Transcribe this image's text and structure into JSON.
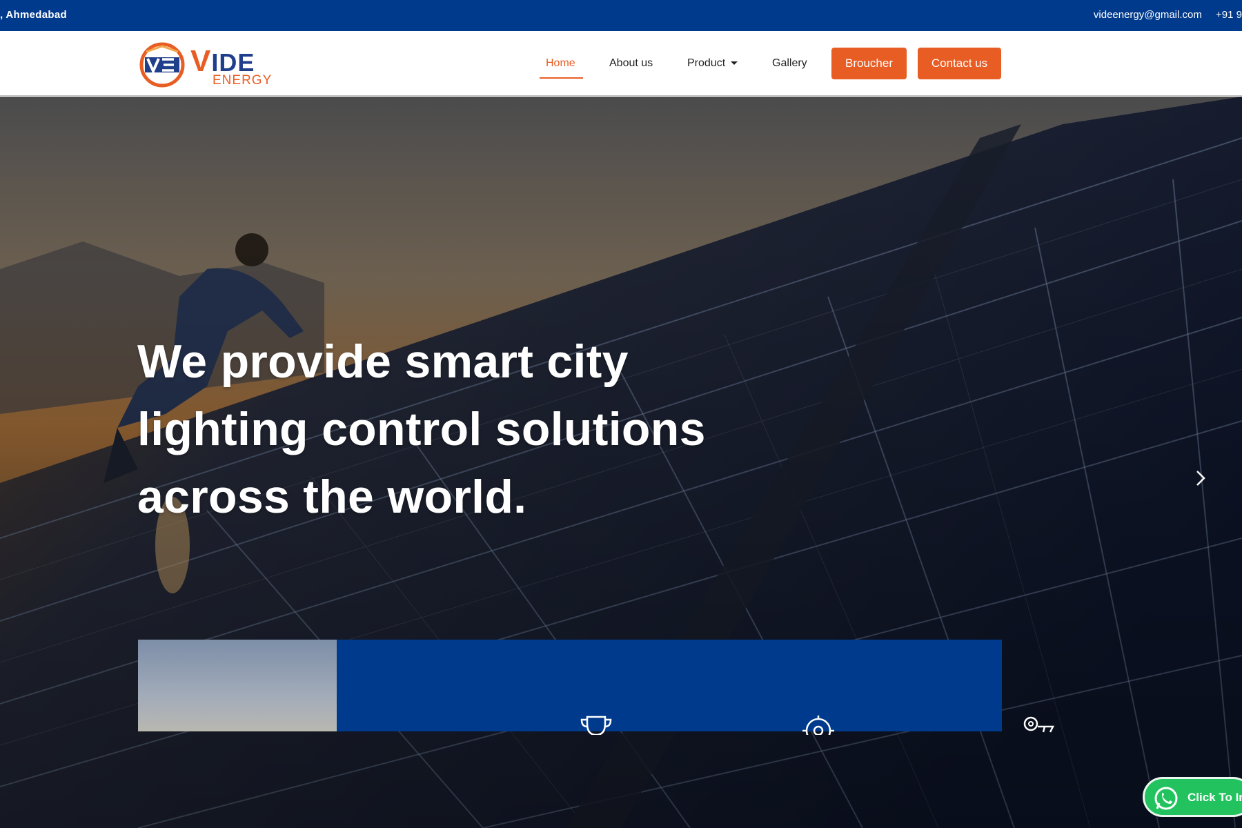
{
  "topbar": {
    "address": ", Ahmedabad",
    "email": "videenergy@gmail.com",
    "phone": "+91 9"
  },
  "brand": {
    "name_vide": "IDE",
    "name_v": "V",
    "name_energy": "ENERGY",
    "colors": {
      "navy": "#1f3e8c",
      "orange": "#e85d24"
    }
  },
  "nav": {
    "items": [
      {
        "label": "Home",
        "active": true
      },
      {
        "label": "About us"
      },
      {
        "label": "Product"
      },
      {
        "label": "Gallery"
      }
    ],
    "broucher_label": "Broucher",
    "contact_label": "Contact us"
  },
  "hero": {
    "heading_lines": [
      "We provide smart city",
      "lighting control solutions",
      "across the world."
    ],
    "next_icon": "chevron-right-icon"
  },
  "features": {
    "icons": [
      "trophy-icon",
      "target-icon",
      "key-icon"
    ]
  },
  "whatsapp": {
    "label": "Click To In",
    "icon": "whatsapp-icon",
    "color": "#22c35e"
  },
  "colors": {
    "topbar": "#003a8c",
    "accent": "#e85d24",
    "panel": "#003a8c"
  }
}
